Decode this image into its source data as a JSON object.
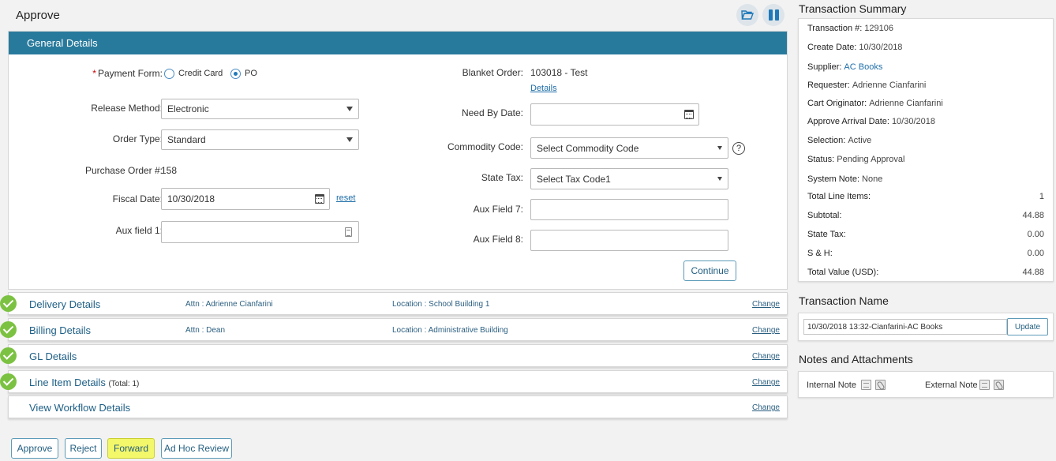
{
  "page": {
    "title": "Approve"
  },
  "general": {
    "header": "General Details",
    "payment_form": {
      "label": "Payment Form:",
      "options": [
        "Credit Card",
        "PO"
      ],
      "selected": "PO"
    },
    "release_method": {
      "label": "Release Method:",
      "value": "Electronic"
    },
    "order_type": {
      "label": "Order Type:",
      "value": "Standard"
    },
    "po_number": {
      "label": "Purchase Order #:",
      "value": "158"
    },
    "fiscal_date": {
      "label": "Fiscal Date:",
      "value": "10/30/2018",
      "reset": "reset"
    },
    "aux_field_1": {
      "label": "Aux field 1:",
      "value": ""
    },
    "blanket_order": {
      "label": "Blanket Order:",
      "value": "103018 - Test",
      "details": "Details"
    },
    "need_by_date": {
      "label": "Need By Date:",
      "value": ""
    },
    "commodity_code": {
      "label": "Commodity Code:",
      "value": "Select Commodity Code",
      "help": "?"
    },
    "state_tax": {
      "label": "State Tax:",
      "value": "Select Tax Code1"
    },
    "aux_field_7": {
      "label": "Aux Field 7:",
      "value": ""
    },
    "aux_field_8": {
      "label": "Aux Field 8:",
      "value": ""
    },
    "continue": "Continue"
  },
  "sections": {
    "delivery": {
      "title": "Delivery Details",
      "attn": "Attn : Adrienne Cianfarini",
      "location": "Location : School Building 1",
      "change": "Change"
    },
    "billing": {
      "title": "Billing Details",
      "attn": "Attn : Dean",
      "location": "Location : Administrative Building",
      "change": "Change"
    },
    "gl": {
      "title": "GL Details",
      "change": "Change"
    },
    "line_item": {
      "title": "Line Item Details",
      "total": "(Total: 1)",
      "change": "Change"
    },
    "workflow": {
      "title": "View Workflow Details",
      "change": "Change"
    }
  },
  "actions": {
    "approve": "Approve",
    "reject": "Reject",
    "forward": "Forward",
    "ad_hoc": "Ad Hoc Review"
  },
  "summary": {
    "title": "Transaction Summary",
    "transaction_no": {
      "label": "Transaction #:",
      "value": "129106"
    },
    "create_date": {
      "label": "Create Date:",
      "value": "10/30/2018"
    },
    "supplier": {
      "label": "Supplier:",
      "value": "AC Books"
    },
    "requester": {
      "label": "Requester:",
      "value": "Adrienne Cianfarini"
    },
    "cart_originator": {
      "label": "Cart Originator:",
      "value": "Adrienne Cianfarini"
    },
    "approve_arrival": {
      "label": "Approve Arrival Date:",
      "value": "10/30/2018"
    },
    "selection": {
      "label": "Selection:",
      "value": "Active"
    },
    "status": {
      "label": "Status:",
      "value": "Pending Approval"
    },
    "system_note": {
      "label": "System Note:",
      "value": "None"
    },
    "total_line_items": {
      "label": "Total Line Items:",
      "value": "1"
    },
    "subtotal": {
      "label": "Subtotal:",
      "value": "44.88"
    },
    "state_tax": {
      "label": "State Tax:",
      "value": "0.00"
    },
    "sh": {
      "label": "S & H:",
      "value": "0.00"
    },
    "total_value": {
      "label": "Total Value (USD):",
      "value": "44.88"
    }
  },
  "transaction_name": {
    "title": "Transaction Name",
    "value": "10/30/2018 13:32-Cianfarini-AC Books",
    "update": "Update"
  },
  "notes": {
    "title": "Notes and Attachments",
    "internal": "Internal Note",
    "external": "External Note"
  }
}
